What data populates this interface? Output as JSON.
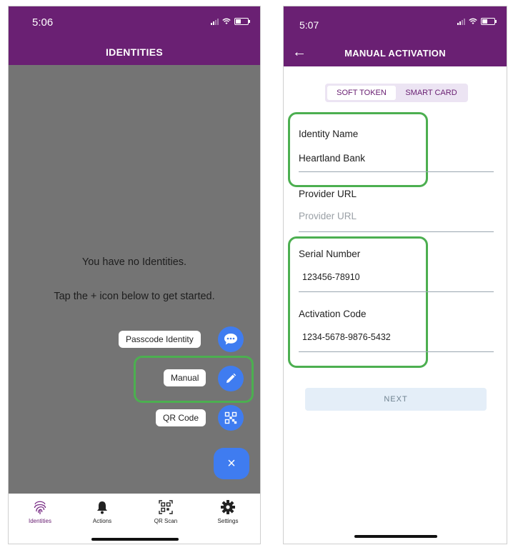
{
  "left_screen": {
    "time": "5:06",
    "title": "IDENTITIES",
    "empty_message": "You have no Identities.",
    "hint": "Tap the + icon below to get started.",
    "fab_menu": {
      "passcode_label": "Passcode Identity",
      "manual_label": "Manual",
      "qr_label": "QR Code",
      "close_symbol": "×"
    },
    "tabs": [
      {
        "label": "Identities",
        "icon": "fingerprint-icon"
      },
      {
        "label": "Actions",
        "icon": "bell-icon"
      },
      {
        "label": "QR Scan",
        "icon": "qr-icon"
      },
      {
        "label": "Settings",
        "icon": "gear-icon"
      }
    ]
  },
  "right_screen": {
    "time": "5:07",
    "title": "MANUAL ACTIVATION",
    "back_icon": "←",
    "segments": {
      "soft_token": "SOFT TOKEN",
      "smart_card": "SMART CARD"
    },
    "fields": {
      "identity_name": {
        "label": "Identity Name",
        "value": "Heartland Bank"
      },
      "provider_url": {
        "label": "Provider URL",
        "placeholder": "Provider URL"
      },
      "serial_number": {
        "label": "Serial Number",
        "value": "123456-78910"
      },
      "activation_code": {
        "label": "Activation Code",
        "value": "1234-5678-9876-5432"
      }
    },
    "next_label": "NEXT"
  },
  "colors": {
    "brand_purple": "#6a2073",
    "accent_blue": "#3f7cf0",
    "highlight_green": "#4caf50",
    "overlay_gray": "#747474"
  }
}
